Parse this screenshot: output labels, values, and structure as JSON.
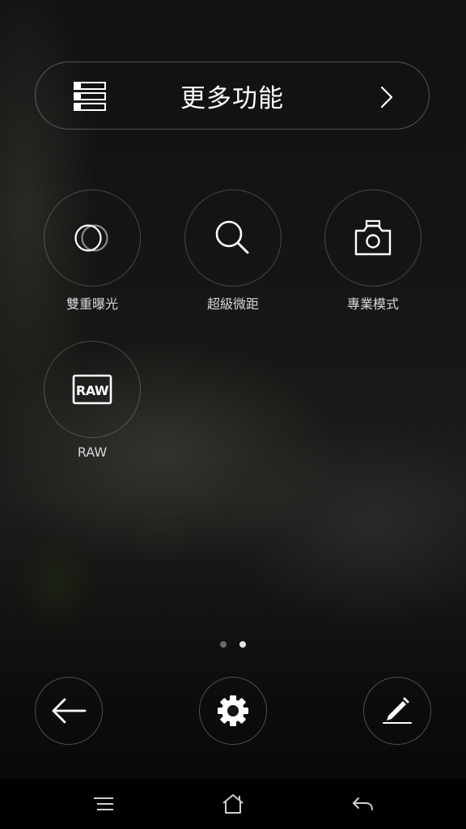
{
  "header": {
    "title": "更多功能",
    "left_icon": "list-icon",
    "right_icon": "chevron-right-icon"
  },
  "modes": [
    {
      "label": "雙重曝光",
      "icon": "double-exposure-icon"
    },
    {
      "label": "超級微距",
      "icon": "magnifier-icon"
    },
    {
      "label": "專業模式",
      "icon": "camera-icon"
    },
    {
      "label": "RAW",
      "icon": "raw-icon",
      "badge": "RAW"
    }
  ],
  "pager": {
    "pages": 2,
    "current": 2
  },
  "actions": {
    "back": "back-arrow-icon",
    "settings": "gear-icon",
    "edit": "edit-pencil-icon"
  },
  "navbar": {
    "menu": "menu-icon",
    "home": "home-icon",
    "back": "back-icon"
  },
  "colors": {
    "text": "#ffffff",
    "label": "#d8d8d8",
    "outline": "#ffffff47"
  }
}
